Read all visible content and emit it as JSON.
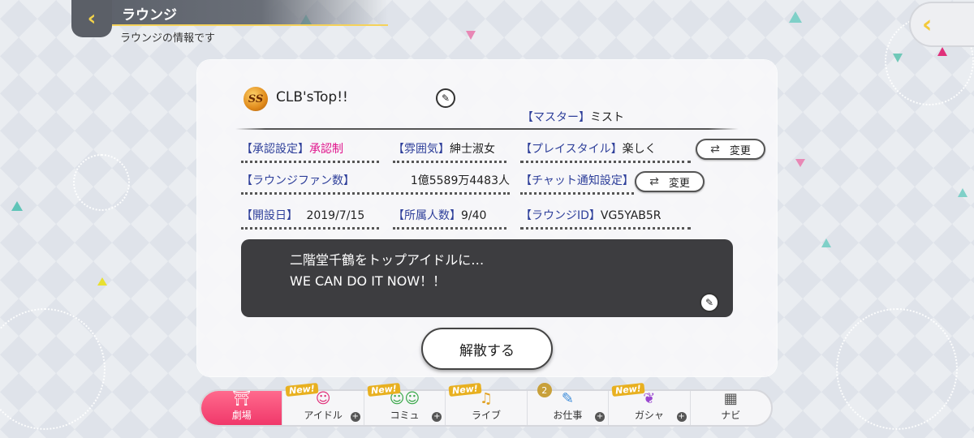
{
  "header": {
    "title": "ラウンジ",
    "subtitle": "ラウンジの情報です"
  },
  "lounge": {
    "badge": "SS",
    "name": "CLB'sTop!!",
    "master_label": "【マスター】",
    "master_value": "ミスト"
  },
  "fields": {
    "approval_label": "【承認設定】",
    "approval_value": "承認制",
    "mood_label": "【雰囲気】",
    "mood_value": "紳士淑女",
    "style_label": "【プレイスタイル】",
    "style_value": "楽しく",
    "fans_label": "【ラウンジファン数】",
    "fans_value": "1億5589万4483人",
    "chat_label": "【チャット通知設定】",
    "opened_label": "【開設日】",
    "opened_value": "2019/7/15",
    "members_label": "【所属人数】",
    "members_value": "9/40",
    "id_label": "【ラウンジID】",
    "id_value": "VG5YAB5R"
  },
  "buttons": {
    "change": "変更",
    "dissolve": "解散する"
  },
  "comment": {
    "line1": "二階堂千鶴をトップアイドルに…",
    "line2": "WE CAN DO IT NOW！！"
  },
  "nav": {
    "items": [
      {
        "label": "劇場",
        "icon": "theater-icon"
      },
      {
        "label": "アイドル",
        "new": "New!",
        "icon": "idol-icon"
      },
      {
        "label": "コミュ",
        "new": "New!",
        "icon": "commu-icon"
      },
      {
        "label": "ライブ",
        "new": "New!",
        "icon": "live-icon"
      },
      {
        "label": "お仕事",
        "count": "2",
        "icon": "work-icon"
      },
      {
        "label": "ガシャ",
        "new": "New!",
        "icon": "gacha-icon"
      },
      {
        "label": "ナビ",
        "icon": "navi-icon"
      }
    ]
  },
  "colors": {
    "accent_pink": "#e0148c",
    "label_blue": "#2e3f9a",
    "nav_active": "#f0386a",
    "back_yellow": "#f3d34a"
  }
}
